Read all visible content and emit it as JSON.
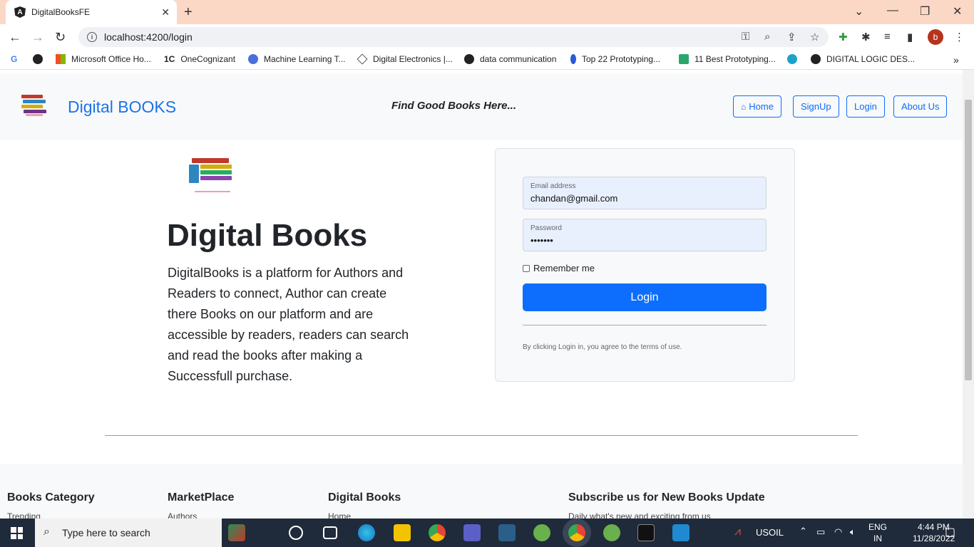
{
  "browser": {
    "tab_title": "DigitalBooksFE",
    "tab_icon": "A",
    "url": "localhost:4200/login",
    "avatar_letter": "b",
    "bookmarks": [
      "Microsoft Office Ho...",
      "OneCognizant",
      "Machine Learning T...",
      "Digital Electronics |...",
      "data communication",
      "Top 22 Prototyping...",
      "11 Best Prototyping...",
      "DIGITAL LOGIC DES..."
    ],
    "bookmark_onecognizant_prefix": "1C"
  },
  "navbar": {
    "brand": "Digital BOOKS",
    "tagline": "Find Good Books Here...",
    "links": {
      "home": "Home",
      "signup": "SignUp",
      "login": "Login",
      "about": "About Us"
    }
  },
  "hero": {
    "title": "Digital Books",
    "description": "DigitalBooks is a platform for Authors and Readers to connect, Author can create there Books on our platform and are accessible by readers, readers can search and read the books after making a Successfull purchase."
  },
  "login_form": {
    "email_label": "Email address",
    "email_value": "chandan@gmail.com",
    "password_label": "Password",
    "password_value": "•••••••",
    "remember_label": "Remember me",
    "remember_checked": false,
    "submit_label": "Login",
    "terms": "By clicking Login in, you agree to the terms of use."
  },
  "footer": {
    "columns": [
      {
        "heading": "Books Category",
        "first_item": "Trending"
      },
      {
        "heading": "MarketPlace",
        "first_item": "Authors"
      },
      {
        "heading": "Digital Books",
        "first_item": "Home"
      },
      {
        "heading": "Subscribe us for New Books Update",
        "first_item": "Daily what's new and exciting from us"
      }
    ]
  },
  "taskbar": {
    "search_placeholder": "Type here to search",
    "weather_label": "USOIL",
    "language": "ENG",
    "region": "IN",
    "time": "4:44 PM",
    "date": "11/28/2022"
  },
  "colors": {
    "accent": "#0d6efd",
    "brand_text": "#1a73e8",
    "tab_strip": "#fbd8c5",
    "taskbar": "#1f2a3a"
  }
}
